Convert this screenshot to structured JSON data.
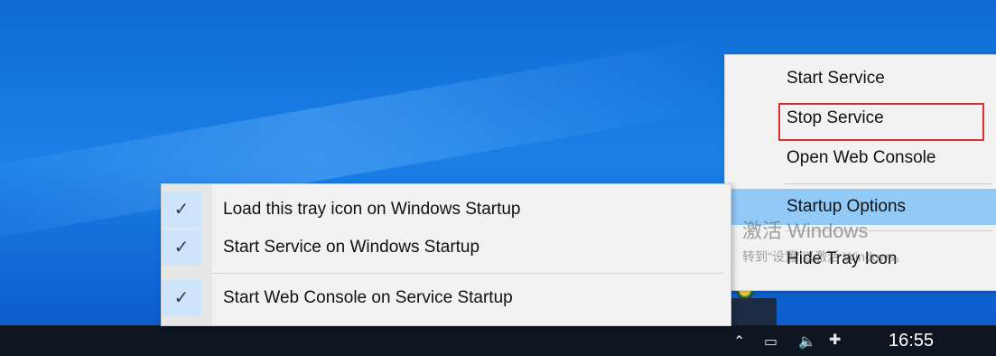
{
  "context_menu": {
    "items": [
      {
        "label": "Start Service"
      },
      {
        "label": "Stop Service",
        "annotated": true
      },
      {
        "label": "Open Web Console"
      },
      {
        "label": "Startup Options",
        "highlighted": true,
        "has_submenu": true
      },
      {
        "label": "Hide Tray Icon"
      }
    ]
  },
  "submenu": {
    "items": [
      {
        "label": "Load this tray icon on Windows Startup",
        "checked": true
      },
      {
        "label": "Start Service on Windows Startup",
        "checked": true
      },
      {
        "label": "Start Web Console on Service Startup",
        "checked": true
      }
    ],
    "check_glyph": "✓"
  },
  "watermark": {
    "line1": "激活 Windows",
    "line2": "转到\"设置\"以激活 Windows。"
  },
  "taskbar": {
    "clock": "16:55"
  },
  "colors": {
    "desktop": "#1a80e6",
    "taskbar": "#0e1622",
    "menu_bg": "#f2f2f2",
    "highlight": "#91c9f7",
    "annotation_red": "#e03030"
  },
  "icons": [
    "tray-app-icon",
    "chevron-up-icon",
    "network-icon",
    "volume-icon",
    "ime-icon",
    "check-icon"
  ]
}
